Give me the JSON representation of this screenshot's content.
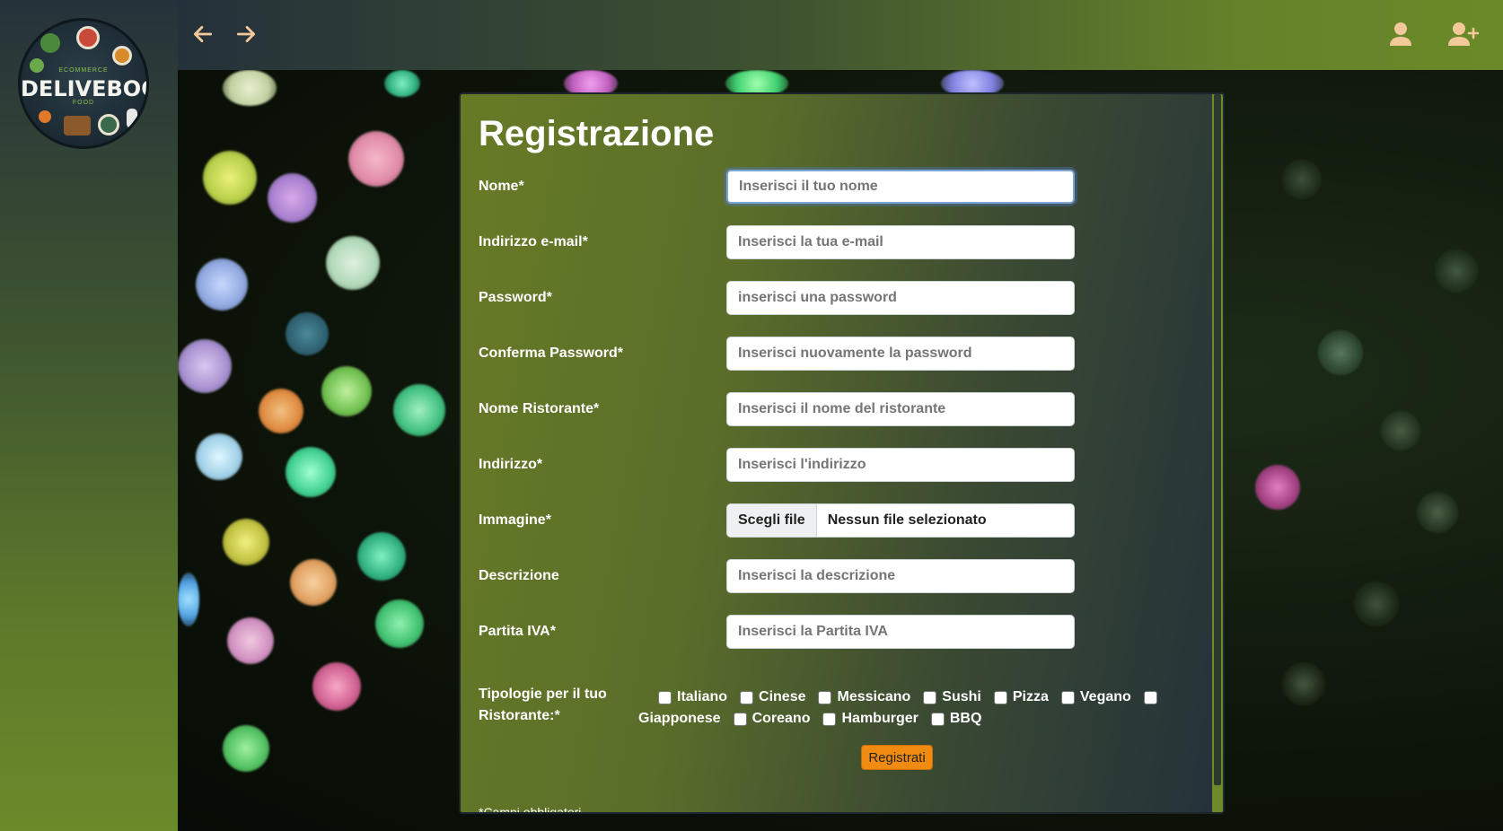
{
  "brand": {
    "name": "DELIVEBOO",
    "tagline_top": "ECOMMERCE",
    "tagline_bottom": "FOOD"
  },
  "topbar": {
    "back_icon": "arrow-left-icon",
    "forward_icon": "arrow-right-icon",
    "user_icon": "user-icon",
    "add_user_icon": "user-plus-icon",
    "icon_color": "#f3c99a"
  },
  "form": {
    "title": "Registrazione",
    "fields": [
      {
        "label": "Nome*",
        "placeholder": "Inserisci il tuo nome"
      },
      {
        "label": "Indirizzo e-mail*",
        "placeholder": "Inserisci la tua e-mail"
      },
      {
        "label": "Password*",
        "placeholder": "inserisci una password"
      },
      {
        "label": "Conferma Password*",
        "placeholder": "Inserisci nuovamente la password"
      },
      {
        "label": "Nome Ristorante*",
        "placeholder": "Inserisci il nome del ristorante"
      },
      {
        "label": "Indirizzo*",
        "placeholder": "Inserisci l'indirizzo"
      },
      {
        "label": "Immagine*",
        "choose_label": "Scegli file",
        "status": "Nessun file selezionato"
      },
      {
        "label": "Descrizione",
        "placeholder": "Inserisci la descrizione"
      },
      {
        "label": "Partita IVA*",
        "placeholder": "Inserisci la Partita IVA"
      }
    ],
    "types_label": "Tipologie per il tuo Ristorante:*",
    "types": [
      "Italiano",
      "Cinese",
      "Messicano",
      "Sushi",
      "Pizza",
      "Vegano",
      "Giapponese",
      "Coreano",
      "Hamburger",
      "BBQ"
    ],
    "submit_label": "Registrati",
    "footnote": "*Campi obbligatori"
  },
  "colors": {
    "accent": "#f08a10",
    "card_start": "#677b26",
    "card_end": "#24313a"
  }
}
